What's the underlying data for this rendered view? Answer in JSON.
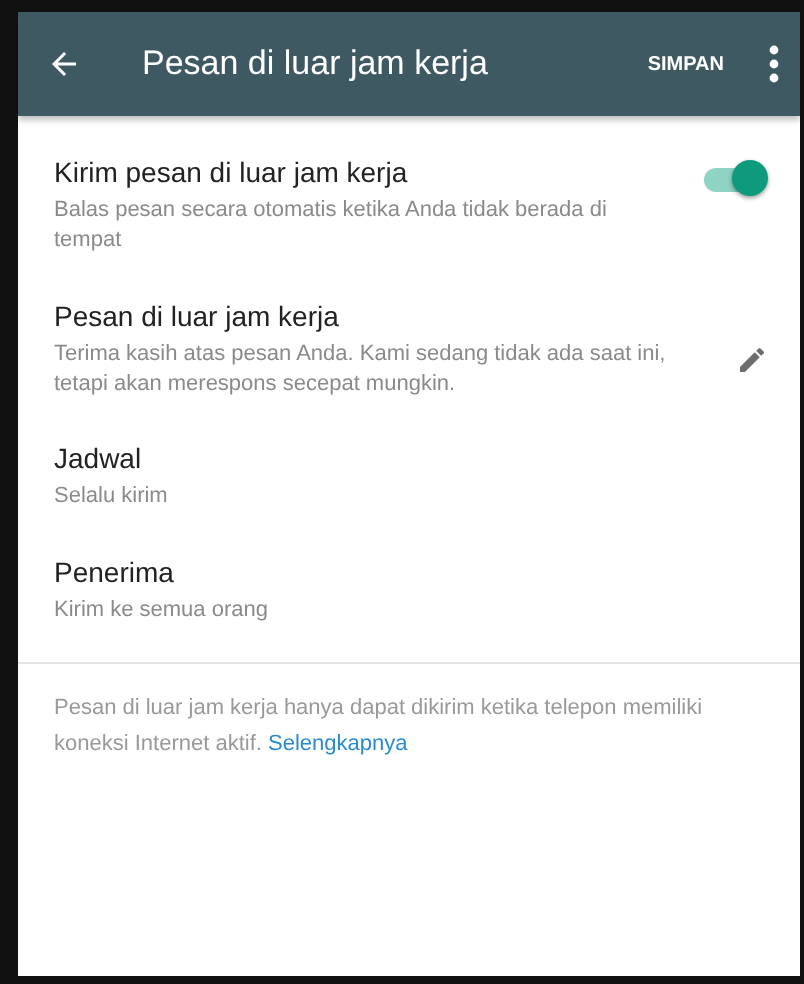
{
  "app_bar": {
    "title": "Pesan di luar jam kerja",
    "action": "SIMPAN"
  },
  "settings": [
    {
      "kind": "toggle",
      "title": "Kirim pesan di luar jam kerja",
      "subtitle": "Balas pesan secara otomatis ketika Anda tidak berada di tempat",
      "on": true
    },
    {
      "kind": "edit",
      "title": "Pesan di luar jam kerja",
      "subtitle": "Terima kasih atas pesan Anda. Kami sedang tidak ada saat ini, tetapi akan merespons secepat mungkin."
    },
    {
      "kind": "plain",
      "title": "Jadwal",
      "subtitle": "Selalu kirim"
    },
    {
      "kind": "plain",
      "title": "Penerima",
      "subtitle": "Kirim ke semua orang"
    }
  ],
  "footer": {
    "text": "Pesan di luar jam kerja hanya dapat dikirim ketika telepon memiliki koneksi Internet aktif.",
    "link": "Selengkapnya"
  }
}
